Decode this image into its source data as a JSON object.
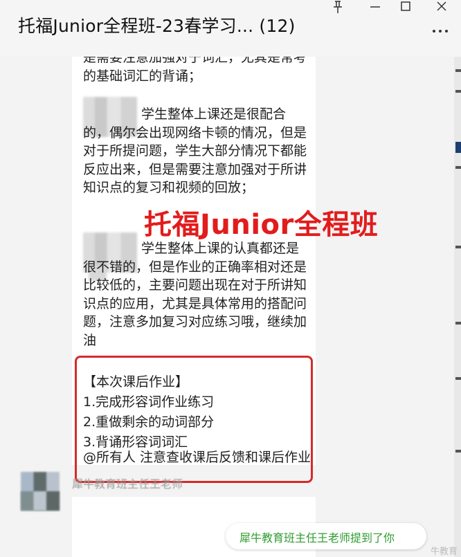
{
  "window": {
    "title": "托福Junior全程班-23春学习... (12)"
  },
  "messages": {
    "m1": {
      "p1": "是需要注意加强对于词汇，尤其是常考的基础词汇的背诵；",
      "p2": "学生整体上课还是很配合的，偶尔会出现网络卡顿的情况，但是对于所提问题，学生大部分情况下都能反应出来，但是需要注意加强对于所讲知识点的复习和视频的回放；",
      "p3": "学生整体上课的认真都还是很不错的，但是作业的正确率相对还是比较低的，主要问题出现在对于所讲知识点的应用，尤其是具体常用的搭配问题，注意多加复习对应练习哦，继续加油",
      "homework": {
        "heading": "【本次课后作业】",
        "items": [
          "1.完成形容词作业练习",
          "2.重做剩余的动词部分",
          "3.背诵形容词词汇"
        ]
      }
    },
    "m2": {
      "sender": "犀牛教育班主任王老师",
      "text": "@所有人 注意查收课后反馈和课后作业"
    }
  },
  "overlay": {
    "watermark": "托福Junior全程班"
  },
  "toast": {
    "text": "犀牛教育班主任王老师提到了你"
  },
  "corner_logo": "牛教育",
  "colors": {
    "watermark": "#e21c1c",
    "highlight_box": "#d62a2a",
    "mention": "#2f9c2f"
  }
}
